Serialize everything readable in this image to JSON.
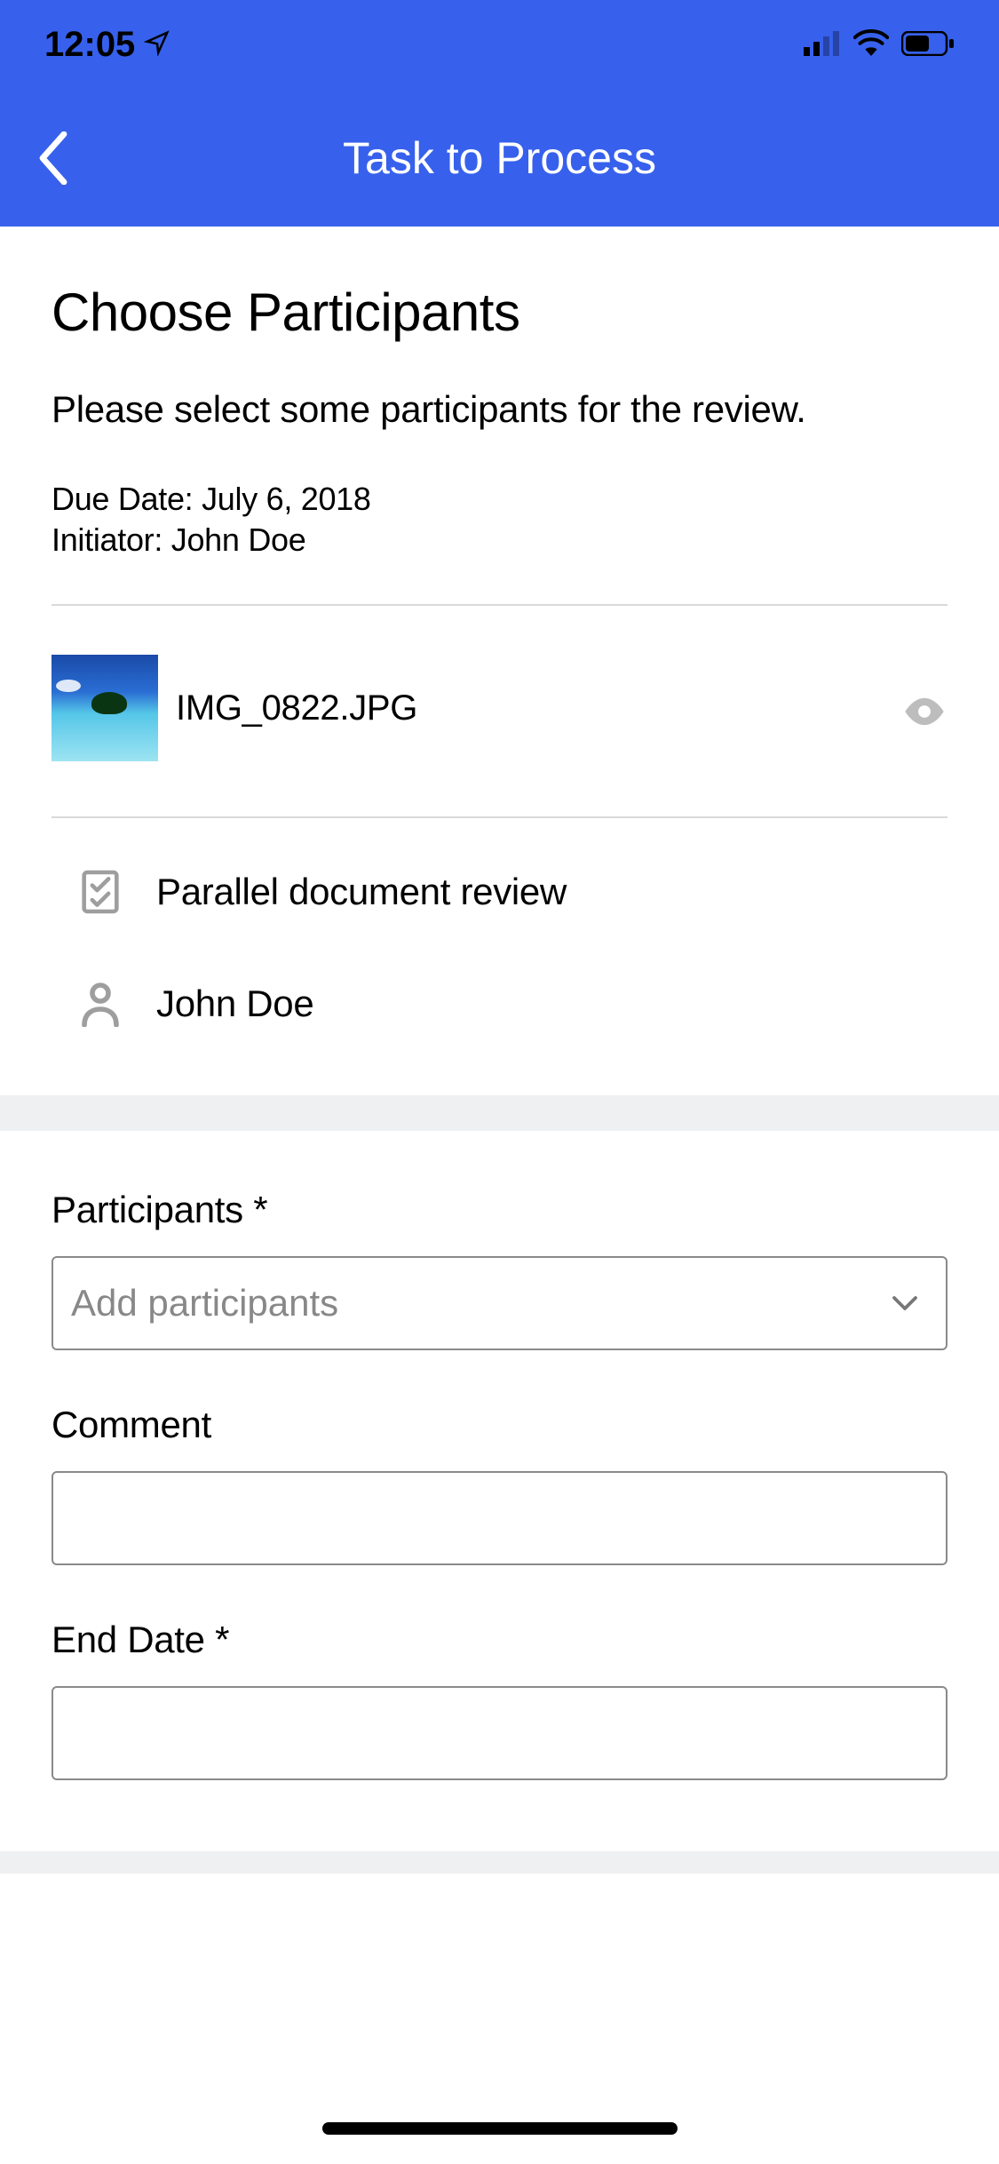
{
  "statusbar": {
    "time": "12:05"
  },
  "nav": {
    "title": "Task to Process"
  },
  "page": {
    "title": "Choose Participants",
    "subtitle": "Please select some participants for the review.",
    "due_date_label": "Due Date: ",
    "due_date_value": "July 6, 2018",
    "initiator_label": "Initiator: ",
    "initiator_value": "John Doe"
  },
  "attachment": {
    "filename": "IMG_0822.JPG"
  },
  "info": {
    "workflow_name": "Parallel document review",
    "person_name": "John Doe"
  },
  "form": {
    "participants_label": "Participants *",
    "participants_placeholder": "Add participants",
    "comment_label": "Comment",
    "end_date_label": "End Date *"
  }
}
